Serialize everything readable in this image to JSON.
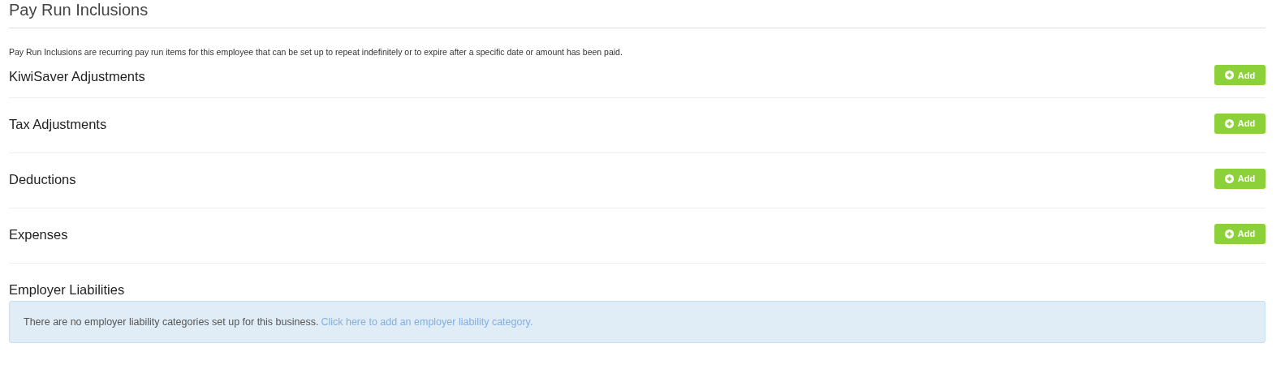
{
  "title": "Pay Run Inclusions",
  "intro": "Pay Run Inclusions are recurring pay run items for this employee that can be set up to repeat indefinitely or to expire after a specific date or amount has been paid.",
  "sections": [
    {
      "kind": "add",
      "heading": "KiwiSaver Adjustments",
      "button": "Add"
    },
    {
      "kind": "add",
      "heading": "Tax Adjustments",
      "button": "Add"
    },
    {
      "kind": "add",
      "heading": "Deductions",
      "button": "Add"
    },
    {
      "kind": "add",
      "heading": "Expenses",
      "button": "Add"
    },
    {
      "kind": "notice",
      "heading": "Employer Liabilities",
      "message": "There are no employer liability categories set up for this business.",
      "link": "Click here to add an employer liability category."
    }
  ]
}
